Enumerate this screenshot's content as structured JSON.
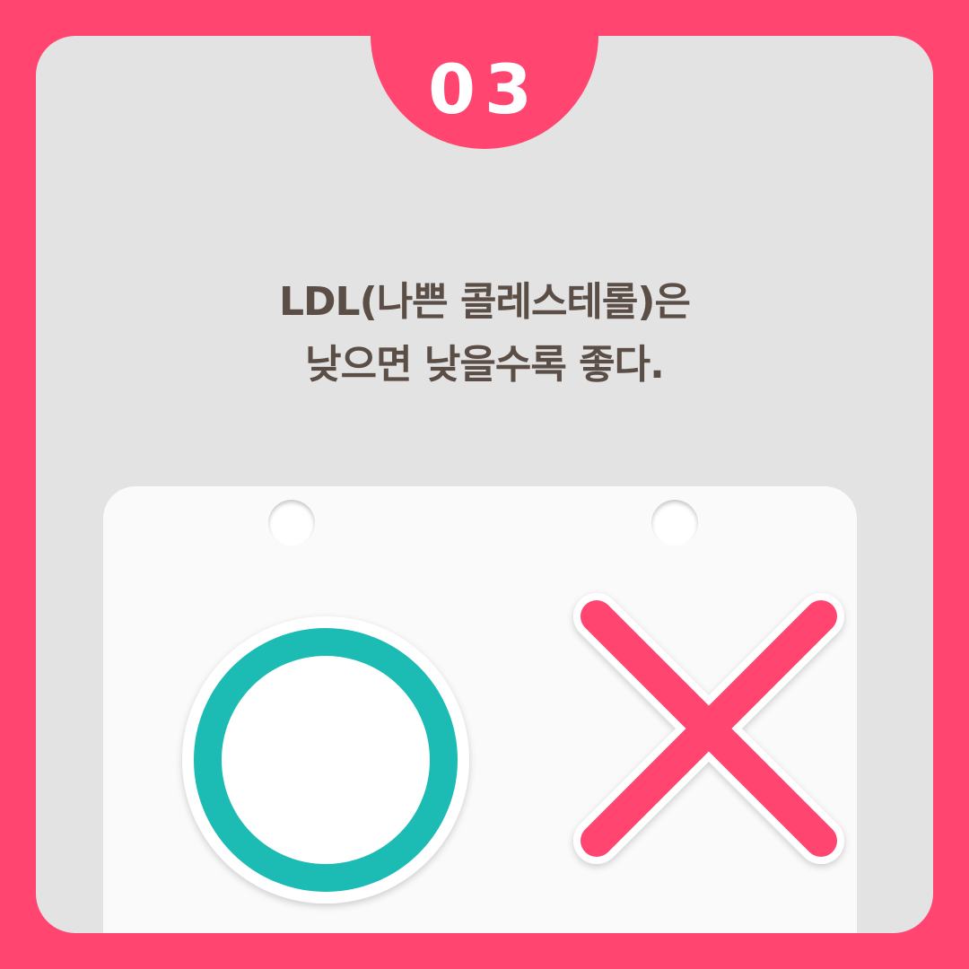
{
  "badge": {
    "number": "03"
  },
  "headline": {
    "line1": "LDL(나쁜 콜레스테롤)은",
    "line2": "낮으면 낮을수록 좋다."
  },
  "marks": {
    "left_icon": "circle-o-icon",
    "right_icon": "x-mark-icon"
  },
  "colors": {
    "frame": "#ff4570",
    "panel": "#e3e3e3",
    "circle": "#1bbcb4",
    "cross": "#ff4570",
    "text": "#5a4e46"
  }
}
